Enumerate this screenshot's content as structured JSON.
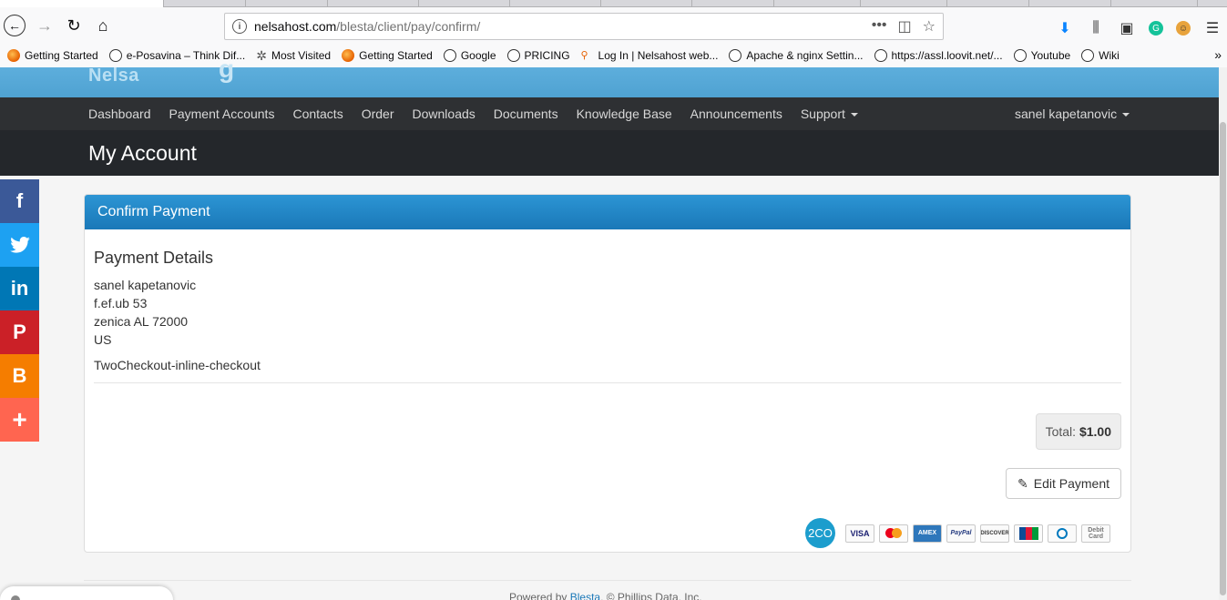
{
  "browser": {
    "url_host": "nelsahost.com",
    "url_path": "/blesta/client/pay/confirm/",
    "bookmarks": [
      {
        "label": "Getting Started",
        "icon": "firefox-icon"
      },
      {
        "label": "e-Posavina – Think Dif...",
        "icon": "globe-icon"
      },
      {
        "label": "Most Visited",
        "icon": "gear-icon"
      },
      {
        "label": "Getting Started",
        "icon": "firefox-icon"
      },
      {
        "label": "Google",
        "icon": "globe-icon"
      },
      {
        "label": "PRICING",
        "icon": "globe-icon"
      },
      {
        "label": "Log In | Nelsahost web...",
        "icon": "person-icon"
      },
      {
        "label": "Apache & nginx Settin...",
        "icon": "globe-icon"
      },
      {
        "label": "https://assl.loovit.net/...",
        "icon": "globe-icon"
      },
      {
        "label": "Youtube",
        "icon": "globe-icon"
      },
      {
        "label": "Wiki",
        "icon": "globe-icon"
      }
    ]
  },
  "site": {
    "logo_text": "Nelsa",
    "nav": [
      "Dashboard",
      "Payment Accounts",
      "Contacts",
      "Order",
      "Downloads",
      "Documents",
      "Knowledge Base",
      "Announcements",
      "Support"
    ],
    "user": "sanel kapetanovic",
    "page_title": "My Account"
  },
  "panel": {
    "heading": "Confirm Payment",
    "details_title": "Payment Details",
    "address": [
      "sanel kapetanovic",
      "f.ef.ub 53",
      "zenica AL 72000",
      "US"
    ],
    "gateway": "TwoCheckout-inline-checkout",
    "total_label": "Total:",
    "total_value": "$1.00",
    "edit_button": "Edit Payment",
    "gateway_logo": "2CO",
    "cards": [
      "VISA",
      "MC",
      "AMEX",
      "PayPal",
      "DISCOVER",
      "JCB",
      "Diners",
      "Debit Card"
    ]
  },
  "footer": {
    "prefix": "Powered by",
    "link": "Blesta",
    "suffix": ", © Phillips Data, Inc."
  },
  "colors": {
    "header_blue": "#5daedc",
    "nav_dark": "#2e3033",
    "title_dark": "#24272b",
    "panel_blue": "#1a78b8",
    "facebook": "#3b5998",
    "twitter": "#1da1f2",
    "linkedin": "#0077b5",
    "pinterest": "#cb2027",
    "blogger": "#f57d00",
    "share": "#ff6550"
  }
}
